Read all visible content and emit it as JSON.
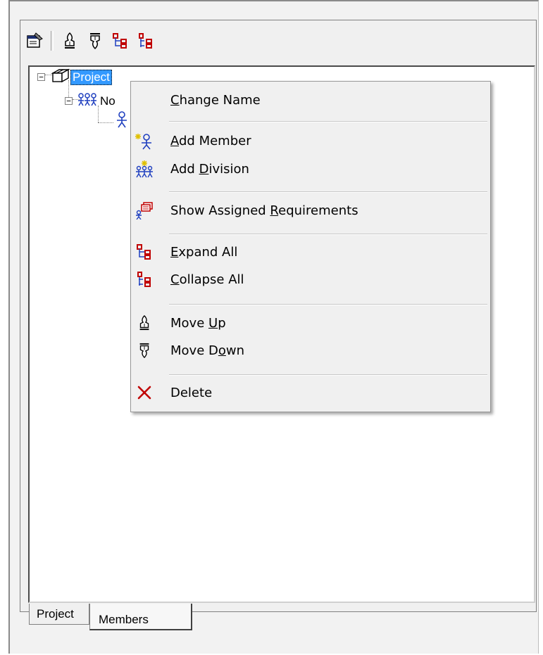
{
  "tree": {
    "root_label": "Project",
    "division_label": "No"
  },
  "tabs": [
    {
      "label": "Project"
    },
    {
      "label": "Members"
    }
  ],
  "context_menu": {
    "items": [
      {
        "pre": "",
        "key": "C",
        "post": "hange Name"
      },
      {
        "pre": "",
        "key": "A",
        "post": "dd Member"
      },
      {
        "pre": "Add ",
        "key": "D",
        "post": "ivision"
      },
      {
        "pre": "Show Assigned ",
        "key": "R",
        "post": "equirements"
      },
      {
        "pre": "",
        "key": "E",
        "post": "xpand All"
      },
      {
        "pre": "",
        "key": "C",
        "post": "ollapse All"
      },
      {
        "pre": "Move ",
        "key": "U",
        "post": "p"
      },
      {
        "pre": "Move D",
        "key": "o",
        "post": "wn"
      },
      {
        "pre": "Delete",
        "key": "",
        "post": ""
      }
    ]
  },
  "icons": {
    "toolbar": [
      "properties-icon",
      "move-up-icon",
      "move-down-icon",
      "expand-all-icon",
      "collapse-all-icon"
    ],
    "delete_color": "#c00000",
    "tree_icon_color": "#1f3fbf",
    "selection_color": "#3399ff"
  }
}
